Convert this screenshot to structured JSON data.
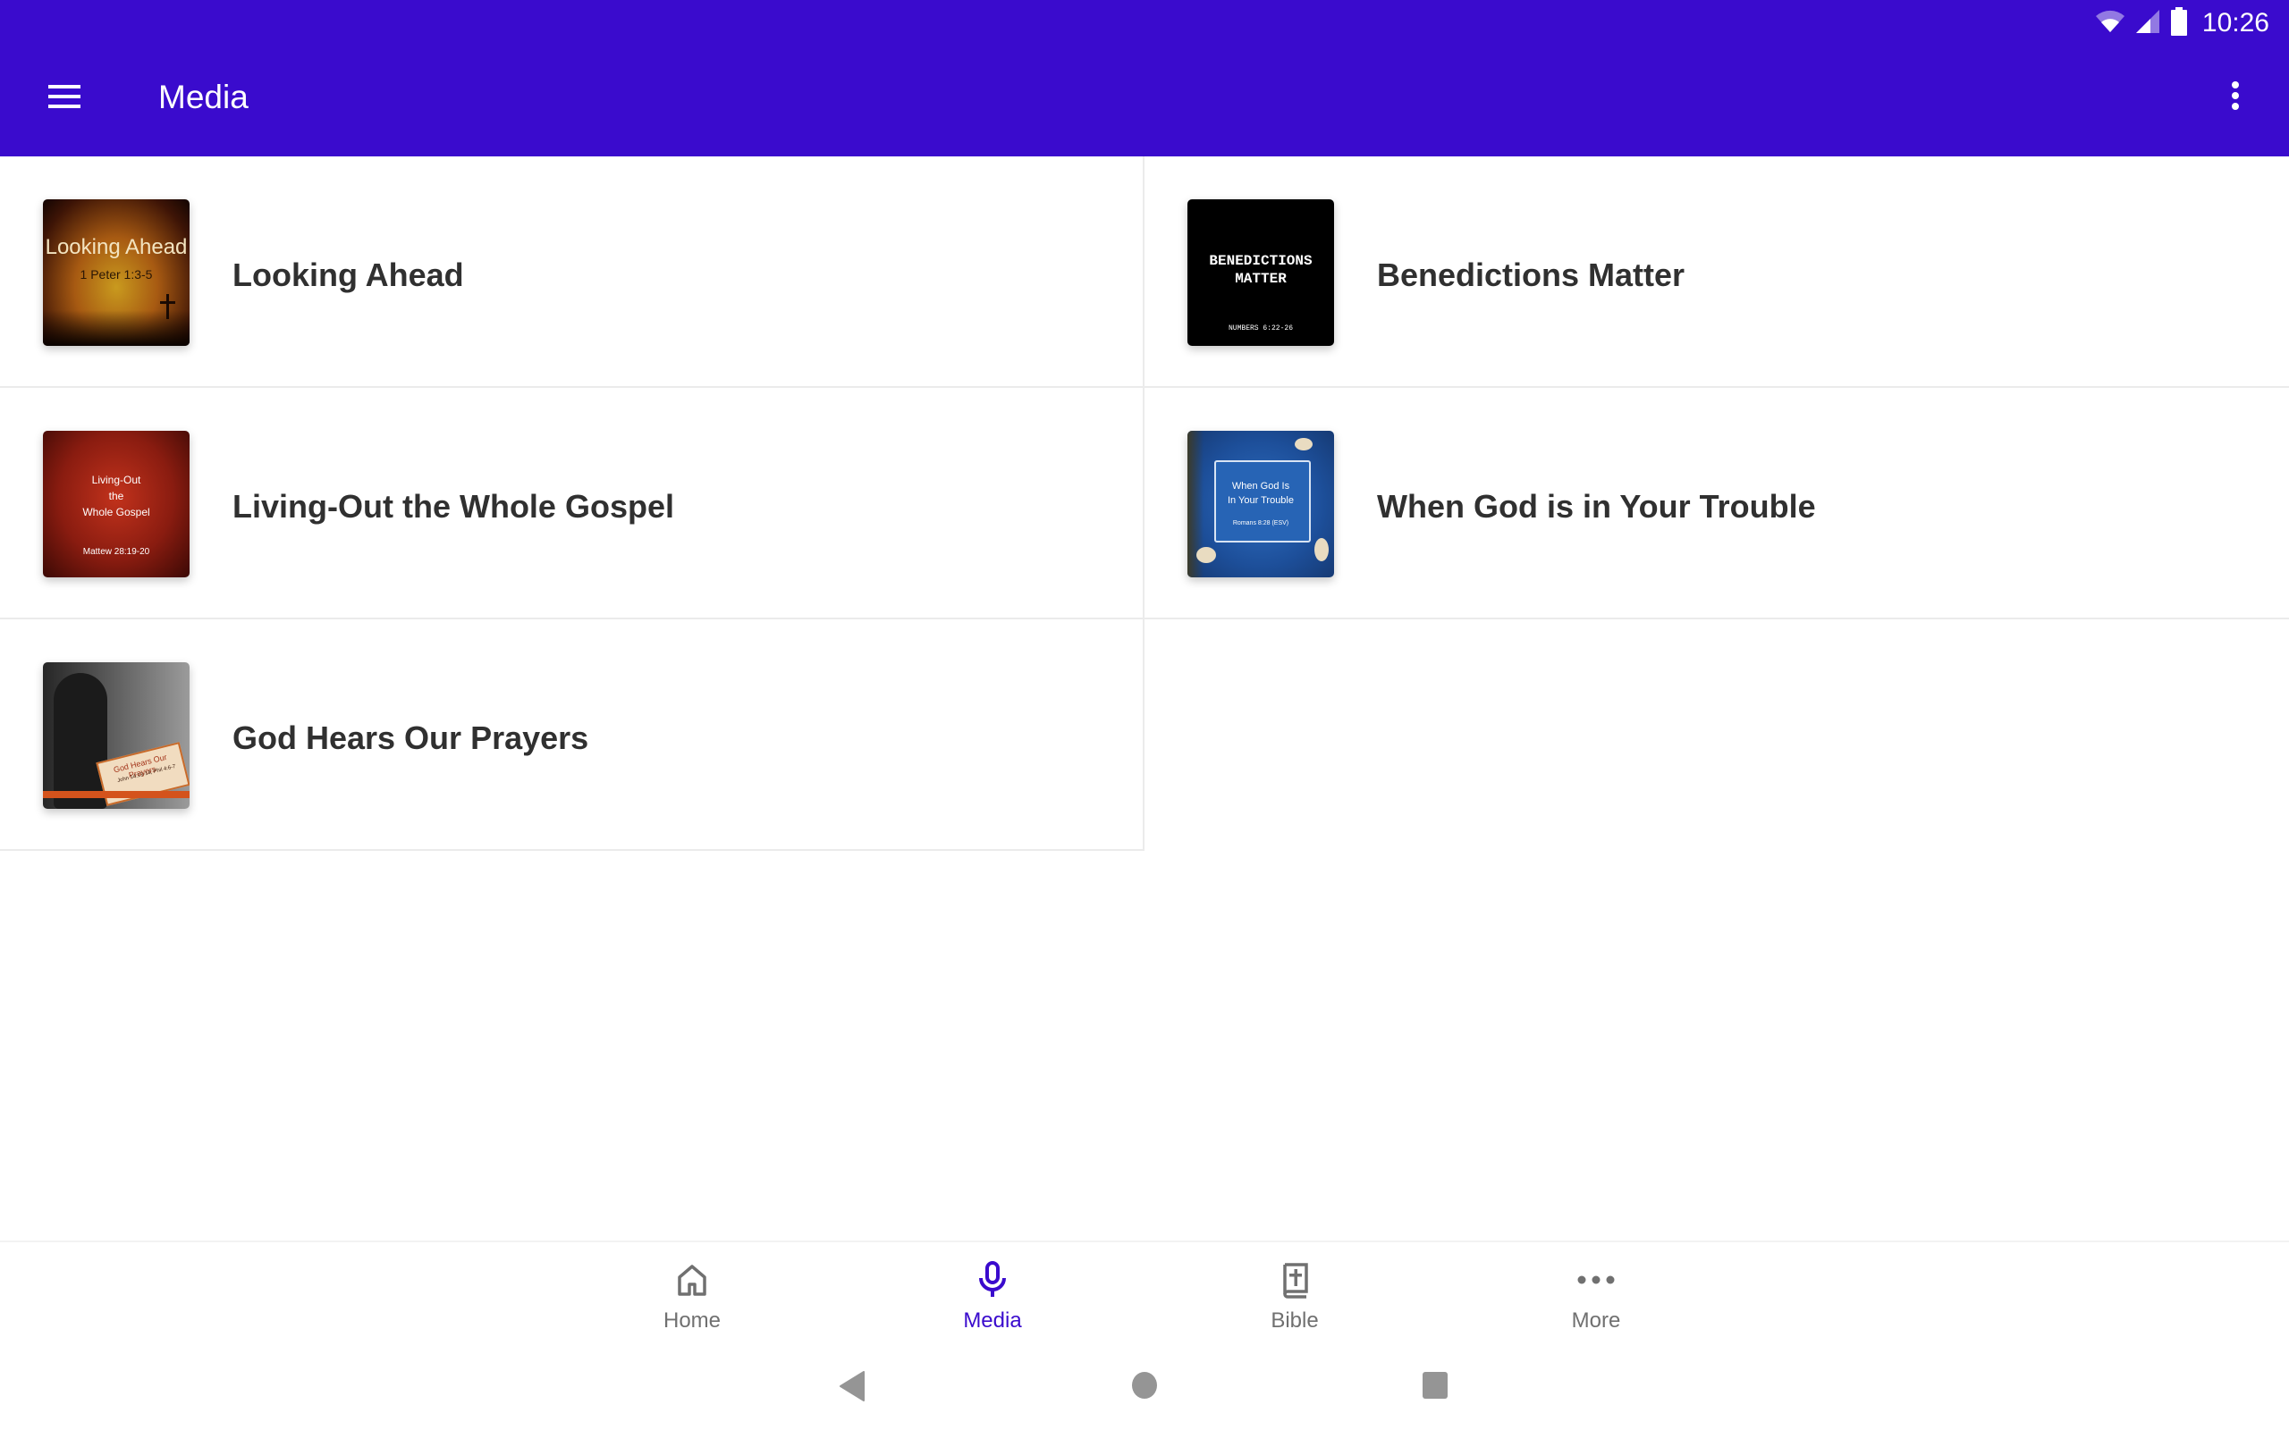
{
  "status_bar": {
    "time": "10:26",
    "icons": [
      "wifi-icon",
      "cellular-signal-icon",
      "battery-icon"
    ]
  },
  "app_bar": {
    "title": "Media",
    "menu_icon": "hamburger-menu-icon",
    "overflow_icon": "more-vert-icon",
    "color": "#3a0bcd"
  },
  "media_items": [
    {
      "title": "Looking Ahead",
      "thumb_line1": "Looking Ahead",
      "thumb_line2": "1 Peter 1:3-5"
    },
    {
      "title": "Benedictions Matter",
      "thumb_line1": "BENEDICTIONS",
      "thumb_line1b": "MATTER",
      "thumb_line2": "NUMBERS 6:22-26"
    },
    {
      "title": "Living-Out the Whole Gospel",
      "thumb_line1": "Living-Out",
      "thumb_line1b": "the",
      "thumb_line1c": "Whole Gospel",
      "thumb_line2": "Mattew 28:19-20"
    },
    {
      "title": "When God is in Your Trouble",
      "thumb_line1": "When God Is",
      "thumb_line1b": "In Your Trouble",
      "thumb_line2": "Romans 8:28 (ESV)"
    },
    {
      "title": "God Hears Our Prayers",
      "thumb_line1": "God Hears Our Prayers",
      "thumb_line2": "John 14:13-14; Phil 4:6-7"
    }
  ],
  "bottom_nav": {
    "active": "Media",
    "active_color": "#3a0bcd",
    "items": [
      {
        "label": "Home",
        "icon": "home-icon"
      },
      {
        "label": "Media",
        "icon": "microphone-icon"
      },
      {
        "label": "Bible",
        "icon": "bible-icon"
      },
      {
        "label": "More",
        "icon": "more-horiz-icon"
      }
    ]
  },
  "system_nav": {
    "buttons": [
      "back-icon",
      "home-circle-icon",
      "recents-icon"
    ]
  }
}
